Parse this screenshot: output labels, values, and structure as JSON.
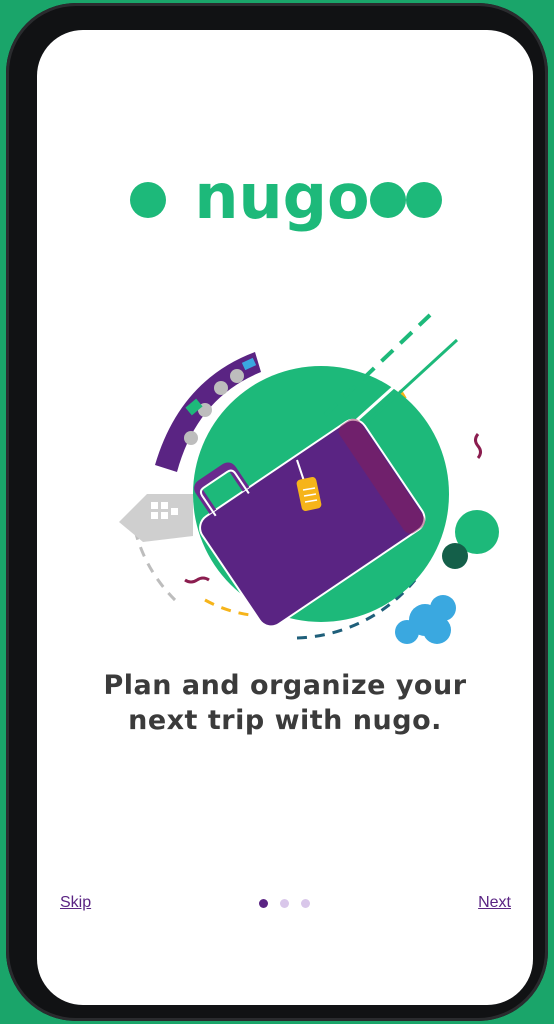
{
  "app": {
    "name": "nugo"
  },
  "logo": {
    "text": "nugo",
    "color": "#1db97a"
  },
  "headline": {
    "line1": "Plan and organize your",
    "line2": "next trip with nugo."
  },
  "footer": {
    "skip_label": "Skip",
    "next_label": "Next",
    "pager": {
      "count": 3,
      "active_index": 0
    }
  },
  "colors": {
    "brand_green": "#1db97a",
    "brand_purple": "#5a2483",
    "tag_yellow": "#f6b41a",
    "cloud_blue": "#3aa8e0",
    "pager_active": "#5a2483",
    "pager_inactive": "#d9c7ea"
  },
  "illustration": {
    "name": "suitcase-travel-illustration"
  }
}
